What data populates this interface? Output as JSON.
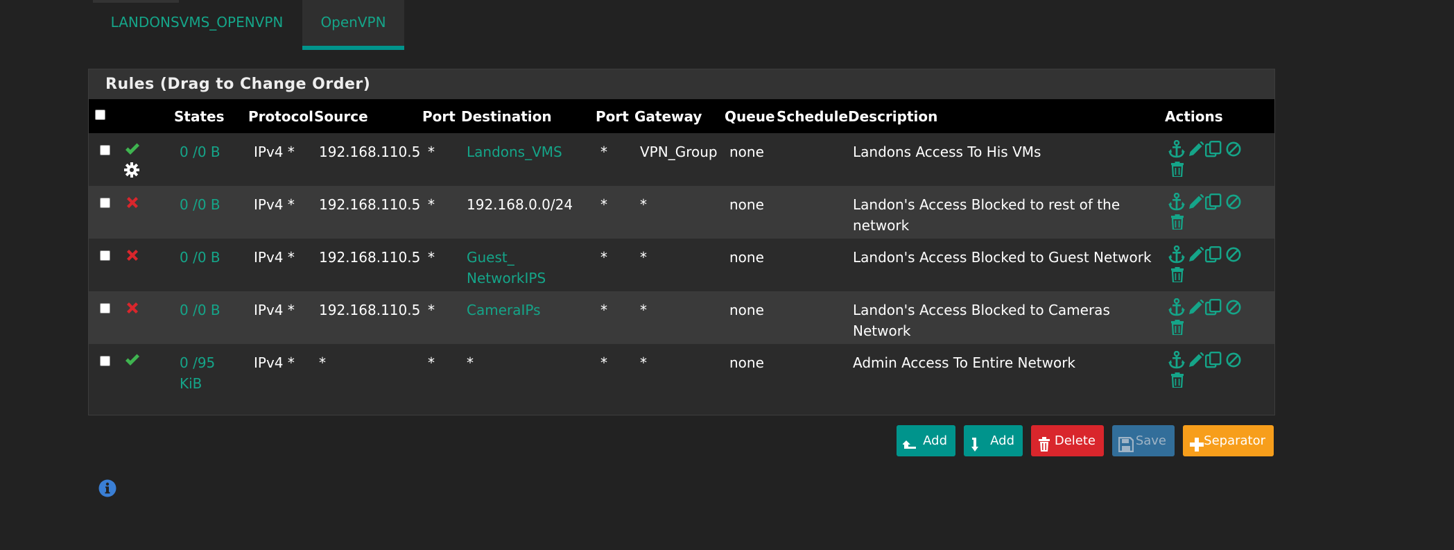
{
  "tabs": [
    {
      "label": "LANDONSVMS_OPENVPN",
      "active": false
    },
    {
      "label": "OpenVPN",
      "active": true
    }
  ],
  "panel": {
    "title": "Rules (Drag to Change Order)"
  },
  "table": {
    "headers": {
      "states": "States",
      "protocol": "Protocol",
      "source": "Source",
      "port": "Port",
      "destination": "Destination",
      "dport": "Port",
      "gateway": "Gateway",
      "queue": "Queue",
      "schedule": "Schedule",
      "description": "Description",
      "actions": "Actions"
    },
    "rows": [
      {
        "action": "pass",
        "states": "0 /0 B",
        "protocol": "IPv4 *",
        "source": "192.168.110.5",
        "sport": "*",
        "destination": "Landons_VMS",
        "destination_link": true,
        "dport": "*",
        "gateway": "VPN_Group",
        "queue": "none",
        "schedule": "",
        "description": "Landons Access To His VMs",
        "advanced": true
      },
      {
        "action": "block",
        "states": "0 /0 B",
        "protocol": "IPv4 *",
        "source": "192.168.110.5",
        "sport": "*",
        "destination": "192.168.0.0/24",
        "destination_link": false,
        "dport": "*",
        "gateway": "*",
        "queue": "none",
        "schedule": "",
        "description": "Landon's Access Blocked to rest of the network",
        "advanced": false
      },
      {
        "action": "block",
        "states": "0 /0 B",
        "protocol": "IPv4 *",
        "source": "192.168.110.5",
        "sport": "*",
        "destination": "Guest_ NetworkIPS",
        "destination_link": true,
        "dport": "*",
        "gateway": "*",
        "queue": "none",
        "schedule": "",
        "description": "Landon's Access Blocked to Guest Network",
        "advanced": false
      },
      {
        "action": "block",
        "states": "0 /0 B",
        "protocol": "IPv4 *",
        "source": "192.168.110.5",
        "sport": "*",
        "destination": "CameraIPs",
        "destination_link": true,
        "dport": "*",
        "gateway": "*",
        "queue": "none",
        "schedule": "",
        "description": "Landon's Access Blocked to Cameras Network",
        "advanced": false
      },
      {
        "action": "pass",
        "states": "0 /95 KiB",
        "protocol": "IPv4 *",
        "source": "*",
        "sport": "*",
        "destination": "*",
        "destination_link": false,
        "dport": "*",
        "gateway": "*",
        "queue": "none",
        "schedule": "",
        "description": "Admin Access To Entire Network",
        "advanced": false
      }
    ]
  },
  "buttons": {
    "add_top": "Add",
    "add_bottom": "Add",
    "delete": "Delete",
    "save": "Save",
    "separator": "Separator"
  },
  "colors": {
    "accent": "#15a589",
    "pass": "#3fb450",
    "block": "#d9262c",
    "delete_btn": "#d9262c",
    "save_btn": "#326e9a",
    "separator_btn": "#f79e1b",
    "info": "#3a7fd5"
  },
  "icons": {
    "pass": "check-icon",
    "block": "times-icon",
    "advanced": "gear-icon",
    "actions": [
      "anchor-icon",
      "pencil-icon",
      "copy-icon",
      "ban-icon",
      "trash-icon"
    ],
    "info": "info-circle-icon"
  }
}
